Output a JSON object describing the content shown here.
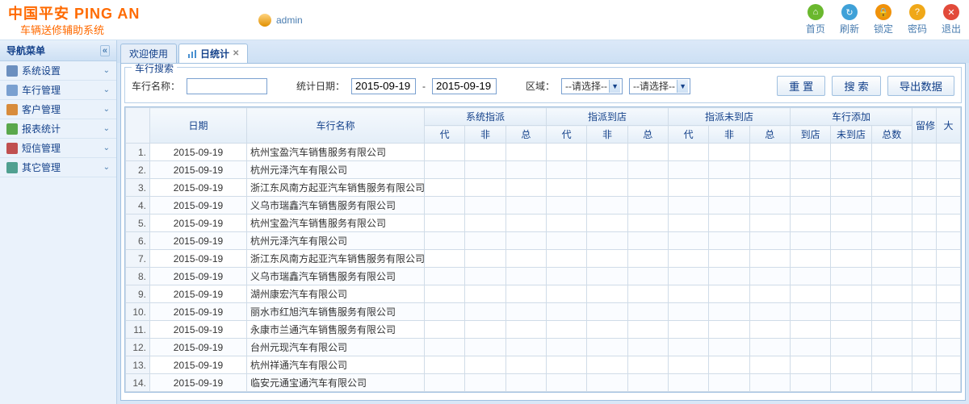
{
  "logo": {
    "main": "中国平安 PING AN",
    "sub": "车辆送修辅助系统"
  },
  "user": "admin",
  "headerButtons": [
    {
      "label": "首页",
      "icon": "⌂",
      "cls": "c-green"
    },
    {
      "label": "刷新",
      "icon": "↻",
      "cls": "c-blue"
    },
    {
      "label": "锁定",
      "icon": "🔒",
      "cls": "c-orange"
    },
    {
      "label": "密码",
      "icon": "?",
      "cls": "c-orange2"
    },
    {
      "label": "退出",
      "icon": "✕",
      "cls": "c-red"
    }
  ],
  "sidebar": {
    "title": "导航菜单",
    "items": [
      {
        "label": "系统设置",
        "icon": "si1"
      },
      {
        "label": "车行管理",
        "icon": "si2"
      },
      {
        "label": "客户管理",
        "icon": "si3"
      },
      {
        "label": "报表统计",
        "icon": "si4"
      },
      {
        "label": "短信管理",
        "icon": "si5"
      },
      {
        "label": "其它管理",
        "icon": "si6"
      }
    ]
  },
  "tabs": [
    {
      "label": "欢迎使用",
      "active": false,
      "closable": false
    },
    {
      "label": "日统计",
      "active": true,
      "closable": true,
      "icon": true
    }
  ],
  "search": {
    "legend": "车行搜索",
    "nameLabel": "车行名称：",
    "nameValue": "",
    "dateLabel": "统计日期：",
    "dateFrom": "2015-09-19",
    "dateSep": "-",
    "dateTo": "2015-09-19",
    "areaLabel": "区域：",
    "areaSel1": "--请选择--",
    "areaSel2": "--请选择--",
    "resetBtn": "重 置",
    "searchBtn": "搜 索",
    "exportBtn": "导出数据"
  },
  "grid": {
    "topHeaders": {
      "date": "日期",
      "name": "车行名称",
      "g1": "系统指派",
      "g2": "指派到店",
      "g3": "指派未到店",
      "g4": "车行添加",
      "liuxiu": "留修",
      "da": "大"
    },
    "subHeaders": {
      "dai": "代",
      "fei": "非",
      "zong": "总",
      "daodian": "到店",
      "weidaodian": "未到店",
      "zongshu": "总数"
    },
    "rows": [
      {
        "date": "2015-09-19",
        "name": "杭州宝盈汽车销售服务有限公司"
      },
      {
        "date": "2015-09-19",
        "name": "杭州元泽汽车有限公司"
      },
      {
        "date": "2015-09-19",
        "name": "浙江东风南方起亚汽车销售服务有限公司"
      },
      {
        "date": "2015-09-19",
        "name": "义乌市瑞鑫汽车销售服务有限公司"
      },
      {
        "date": "2015-09-19",
        "name": "杭州宝盈汽车销售服务有限公司"
      },
      {
        "date": "2015-09-19",
        "name": "杭州元泽汽车有限公司"
      },
      {
        "date": "2015-09-19",
        "name": "浙江东风南方起亚汽车销售服务有限公司"
      },
      {
        "date": "2015-09-19",
        "name": "义乌市瑞鑫汽车销售服务有限公司"
      },
      {
        "date": "2015-09-19",
        "name": "湖州康宏汽车有限公司"
      },
      {
        "date": "2015-09-19",
        "name": "丽水市红旭汽车销售服务有限公司"
      },
      {
        "date": "2015-09-19",
        "name": "永康市兰通汽车销售服务有限公司"
      },
      {
        "date": "2015-09-19",
        "name": "台州元现汽车有限公司"
      },
      {
        "date": "2015-09-19",
        "name": "杭州祥通汽车有限公司"
      },
      {
        "date": "2015-09-19",
        "name": "临安元通宝通汽车有限公司"
      }
    ]
  }
}
